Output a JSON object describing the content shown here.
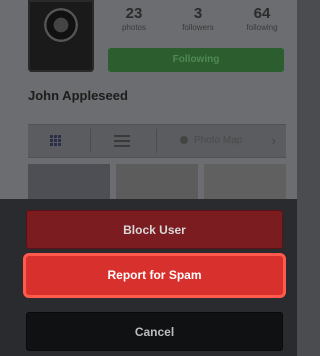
{
  "profile": {
    "stats": [
      {
        "value": "23",
        "label": "photos"
      },
      {
        "value": "3",
        "label": "followers"
      },
      {
        "value": "64",
        "label": "following"
      }
    ],
    "following_button": "Following",
    "username": "John Appleseed",
    "view_bar": {
      "photo_map_label": "Photo Map"
    }
  },
  "action_sheet": {
    "block_label": "Block User",
    "report_label": "Report for Spam",
    "cancel_label": "Cancel"
  },
  "colors": {
    "report_accent": "#d8302c",
    "block_fill": "#7a1c20",
    "following_green": "#2b5d2e"
  }
}
